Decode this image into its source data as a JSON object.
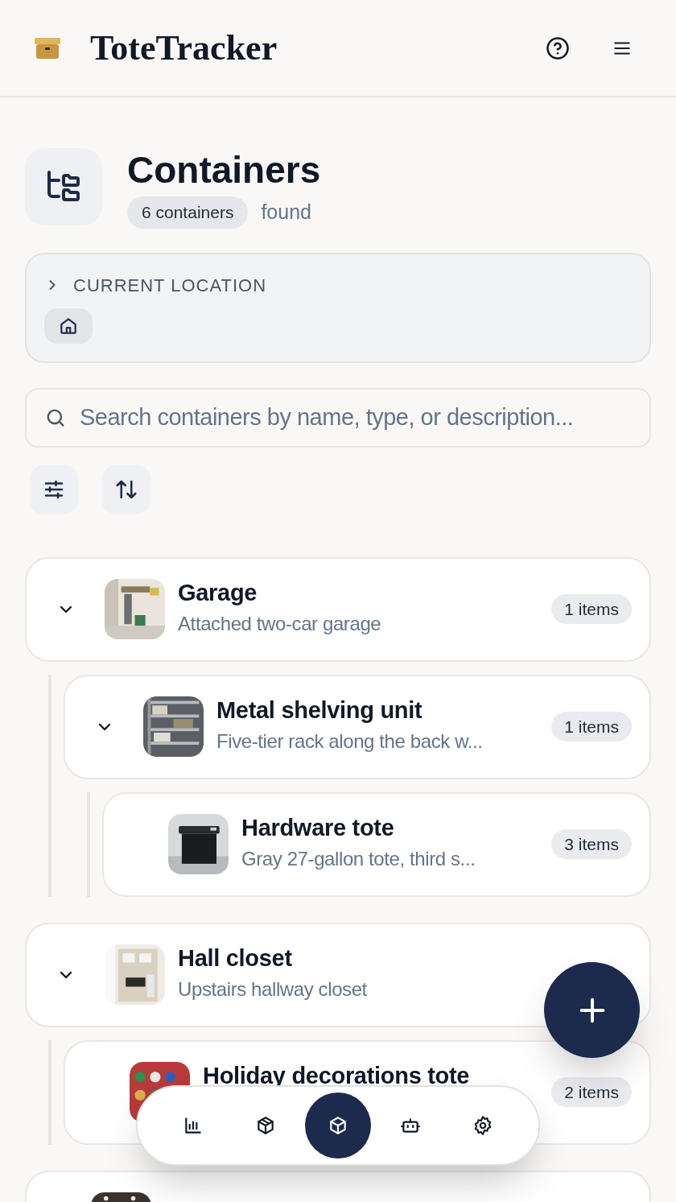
{
  "app": {
    "title": "ToteTracker"
  },
  "page": {
    "title": "Containers",
    "count_badge": "6 containers",
    "count_suffix": "found"
  },
  "location": {
    "label": "CURRENT LOCATION",
    "expanded": false
  },
  "search": {
    "placeholder": "Search containers by name, type, or description..."
  },
  "containers": [
    {
      "name": "Garage",
      "description": "Attached two-car garage",
      "count": "1 items",
      "expanded": true,
      "children": [
        {
          "name": "Metal shelving unit",
          "description": "Five-tier rack along the back w...",
          "count": "1 items",
          "expanded": true,
          "children": [
            {
              "name": "Hardware tote",
              "description": "Gray 27-gallon tote, third s...",
              "count": "3 items"
            }
          ]
        }
      ]
    },
    {
      "name": "Hall closet",
      "description": "Upstairs hallway closet",
      "expanded": true,
      "children": [
        {
          "name": "Holiday decorations tote",
          "count": "2 items"
        }
      ]
    },
    {
      "kind": "picture"
    }
  ],
  "nav": [
    {
      "kind": "chart",
      "selected": false
    },
    {
      "kind": "package",
      "selected": false
    },
    {
      "kind": "box",
      "selected": true
    },
    {
      "kind": "bot",
      "selected": false
    },
    {
      "kind": "settings",
      "selected": false
    }
  ]
}
